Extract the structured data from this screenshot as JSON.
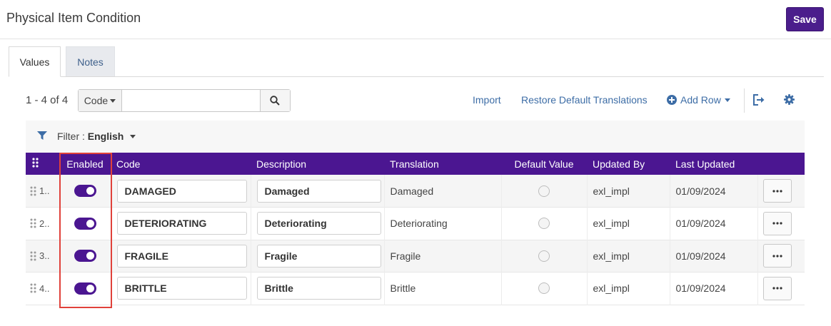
{
  "header": {
    "title": "Physical Item Condition",
    "save_label": "Save"
  },
  "tabs": [
    {
      "label": "Values",
      "active": true
    },
    {
      "label": "Notes",
      "active": false
    }
  ],
  "toolbar": {
    "count": "1 - 4 of 4",
    "search_field": "Code",
    "search_placeholder": "",
    "import_label": "Import",
    "restore_label": "Restore Default Translations",
    "add_row_label": "Add Row"
  },
  "filter": {
    "label": "Filter :",
    "value": "English"
  },
  "table": {
    "columns": [
      "Enabled",
      "Code",
      "Description",
      "Translation",
      "Default Value",
      "Updated By",
      "Last Updated"
    ],
    "rows": [
      {
        "num": "1..",
        "code": "DAMAGED",
        "description": "Damaged",
        "translation": "Damaged",
        "updated_by": "exl_impl",
        "last_updated": "01/09/2024"
      },
      {
        "num": "2..",
        "code": "DETERIORATING",
        "description": "Deteriorating",
        "translation": "Deteriorating",
        "updated_by": "exl_impl",
        "last_updated": "01/09/2024"
      },
      {
        "num": "3..",
        "code": "FRAGILE",
        "description": "Fragile",
        "translation": "Fragile",
        "updated_by": "exl_impl",
        "last_updated": "01/09/2024"
      },
      {
        "num": "4..",
        "code": "BRITTLE",
        "description": "Brittle",
        "translation": "Brittle",
        "updated_by": "exl_impl",
        "last_updated": "01/09/2024"
      }
    ]
  },
  "colors": {
    "primary": "#4b1691",
    "link": "#3d6da6",
    "highlight": "#e0413a"
  },
  "icons": [
    "search-icon",
    "filter-icon",
    "plus-circle-icon",
    "export-icon",
    "gear-icon",
    "drag-handle-icon",
    "more-icon"
  ]
}
